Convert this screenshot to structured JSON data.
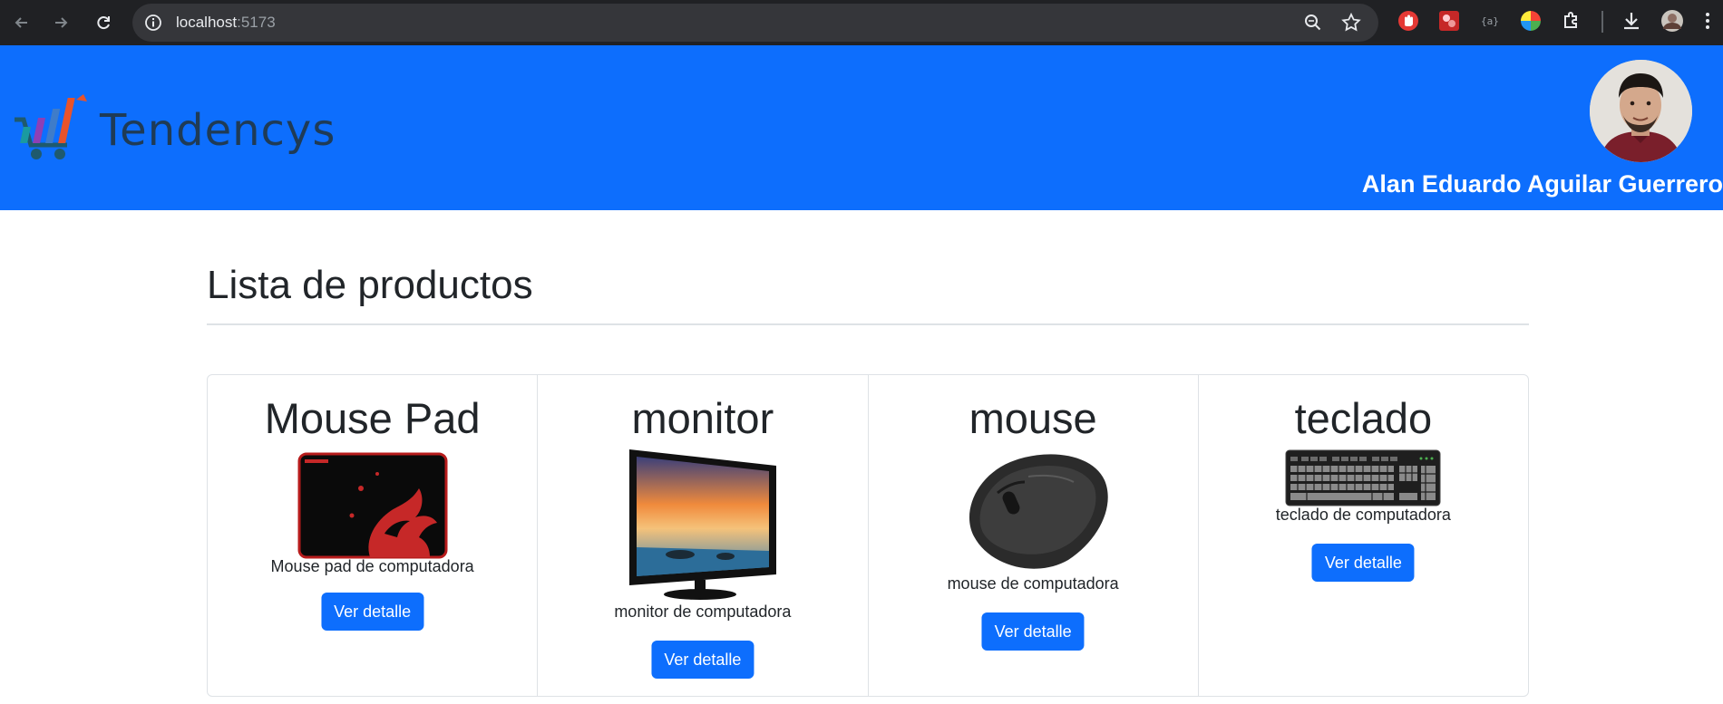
{
  "browser": {
    "url_host": "localhost",
    "url_port": ":5173"
  },
  "header": {
    "brand_name": "Tendencys",
    "user_name": "Alan Eduardo Aguilar Guerrero",
    "bg_color": "#0d6efd"
  },
  "main": {
    "title": "Lista de productos",
    "products": [
      {
        "name": "Mouse Pad",
        "description": "Mouse pad de computadora",
        "button_label": "Ver detalle",
        "image": "mouse-pad-image"
      },
      {
        "name": "monitor",
        "description": "monitor de computadora",
        "button_label": "Ver detalle",
        "image": "monitor-image"
      },
      {
        "name": "mouse",
        "description": "mouse de computadora",
        "button_label": "Ver detalle",
        "image": "mouse-image"
      },
      {
        "name": "teclado",
        "description": "teclado de computadora",
        "button_label": "Ver detalle",
        "image": "keyboard-image"
      }
    ]
  },
  "colors": {
    "primary": "#0d6efd",
    "chrome_bg": "#202124"
  }
}
